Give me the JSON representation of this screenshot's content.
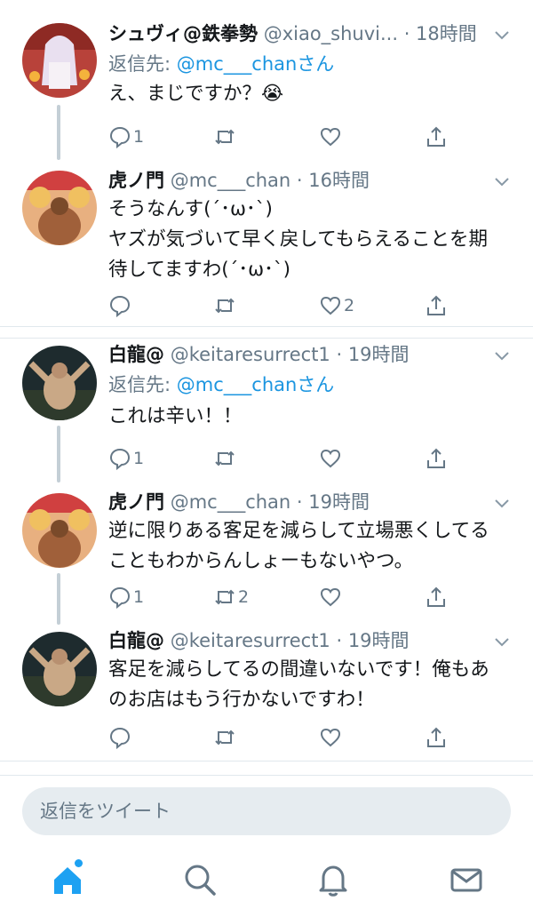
{
  "colors": {
    "accent": "#1da1f2",
    "mention": "#1b95e0",
    "muted": "#657786",
    "thread_line": "#c4cfd6"
  },
  "tweets": [
    {
      "name": "シュヴィ@鉄拳勢",
      "handle": "@xiao_shuvi... · 18時間",
      "reply_prefix": "返信先: ",
      "reply_mention": "@mc___chanさん",
      "lines": [
        "え、まじですか？😭"
      ],
      "reply_count": "1",
      "retweet_count": "",
      "like_count": ""
    },
    {
      "name": "虎ノ門",
      "handle": "@mc___chan · 16時間",
      "lines": [
        "そうなんす(´･ω･`)",
        "ヤズが気づいて早く戻してもらえることを期",
        "待してますわ(´･ω･`)"
      ],
      "reply_count": "",
      "retweet_count": "",
      "like_count": "2"
    },
    {
      "name": "白龍@",
      "handle": "@keitaresurrect1 · 19時間",
      "reply_prefix": "返信先: ",
      "reply_mention": "@mc___chanさん",
      "lines": [
        "これは辛い！！"
      ],
      "reply_count": "1",
      "retweet_count": "",
      "like_count": ""
    },
    {
      "name": "虎ノ門",
      "handle": "@mc___chan · 19時間",
      "lines": [
        "逆に限りある客足を減らして立場悪くしてる",
        "こともわからんしょーもないやつ。"
      ],
      "reply_count": "1",
      "retweet_count": "2",
      "like_count": ""
    },
    {
      "name": "白龍@",
      "handle": "@keitaresurrect1 · 19時間",
      "lines": [
        "客足を減らしてるの間違いないです！俺もあ",
        "のお店はもう行かないですわ！"
      ],
      "reply_count": "",
      "retweet_count": "",
      "like_count": ""
    }
  ],
  "composer": {
    "placeholder": "返信をツイート"
  },
  "tabs": [
    "home-icon",
    "search-icon",
    "notifications-icon",
    "messages-icon"
  ]
}
